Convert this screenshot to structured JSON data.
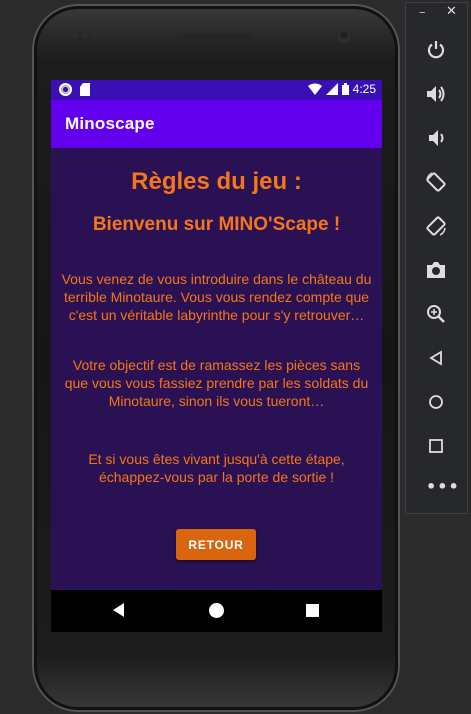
{
  "status_bar": {
    "time": "4:25"
  },
  "app": {
    "title": "Minoscape"
  },
  "rules": {
    "heading": "Règles du jeu :",
    "welcome": "Bienvenu sur MINO'Scape !",
    "paragraph1": "Vous venez de vous introduire dans le château du terrible Minotaure. Vous vous rendez compte que c'est un véritable labyrinthe pour s'y retrouver…",
    "paragraph2": "Votre objectif est de ramassez les pièces sans que vous vous fassiez prendre par les soldats du Minotaure, sinon ils vous tueront…",
    "paragraph3": "Et si vous êtes vivant jusqu'à cette étape, échappez-vous par la porte de sortie !",
    "button_label": "RETOUR"
  },
  "colors": {
    "status_bar": "#3a0fb6",
    "app_bar": "#6200ee",
    "background": "#2a1154",
    "accent_text": "#f5761a",
    "button": "#d9650f"
  },
  "emulator_panel": {
    "icons": [
      "power-icon",
      "volume-up-icon",
      "volume-down-icon",
      "rotate-left-icon",
      "rotate-right-icon",
      "screenshot-icon",
      "zoom-icon",
      "back-icon",
      "home-icon",
      "overview-icon",
      "more-icon"
    ]
  }
}
